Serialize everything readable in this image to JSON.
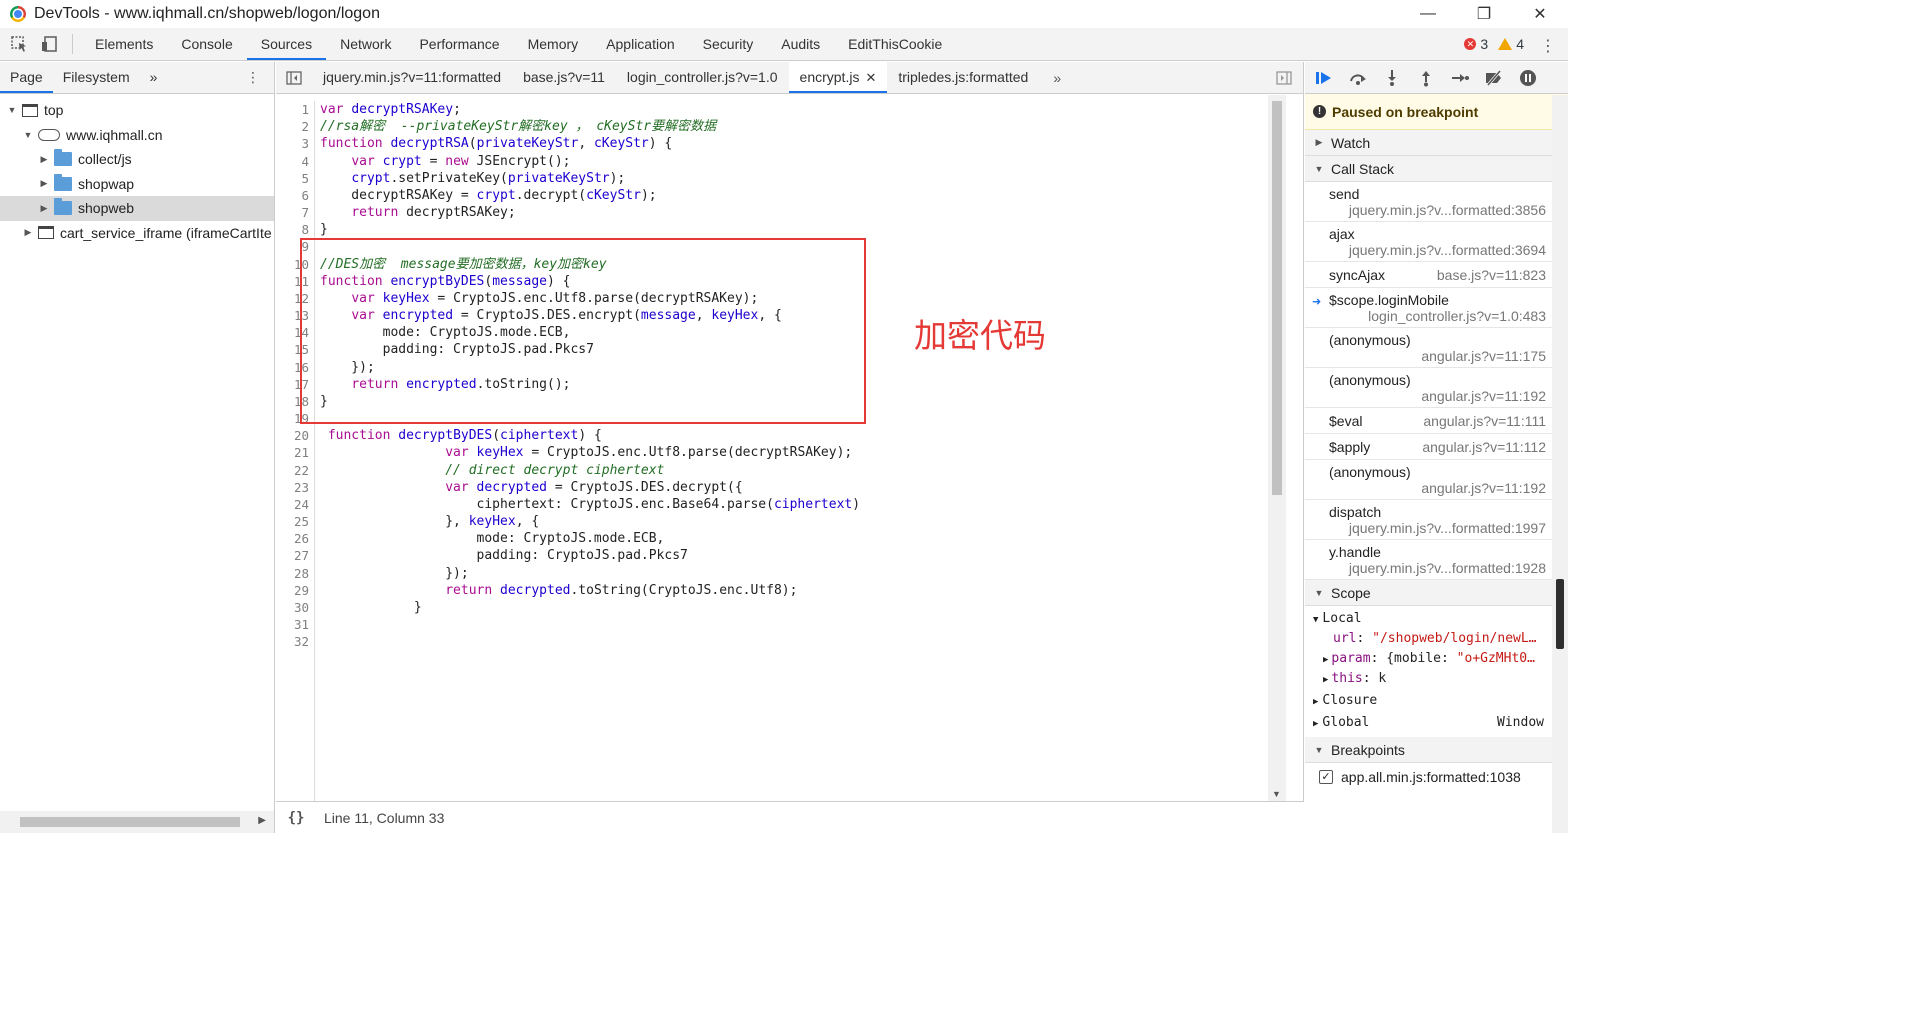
{
  "window": {
    "title": "DevTools - www.iqhmall.cn/shopweb/logon/logon",
    "minimize": "—",
    "restore": "❐",
    "close": "✕"
  },
  "toolbar": {
    "tabs": [
      "Elements",
      "Console",
      "Sources",
      "Network",
      "Performance",
      "Memory",
      "Application",
      "Security",
      "Audits",
      "EditThisCookie"
    ],
    "active_tab": "Sources",
    "error_count": "3",
    "warning_count": "4"
  },
  "navigator": {
    "tabs": [
      "Page",
      "Filesystem"
    ],
    "more": "»",
    "tree": [
      {
        "label": "top",
        "indent": 0,
        "icon": "frame",
        "expanded": true
      },
      {
        "label": "www.iqhmall.cn",
        "indent": 1,
        "icon": "cloud",
        "expanded": true
      },
      {
        "label": "collect/js",
        "indent": 2,
        "icon": "folder",
        "expanded": false
      },
      {
        "label": "shopwap",
        "indent": 2,
        "icon": "folder",
        "expanded": false
      },
      {
        "label": "shopweb",
        "indent": 2,
        "icon": "folder",
        "expanded": false,
        "selected": true
      },
      {
        "label": "cart_service_iframe (iframeCartIte",
        "indent": 1,
        "icon": "frame",
        "expanded": false
      }
    ]
  },
  "editor": {
    "tabs": [
      "jquery.min.js?v=11:formatted",
      "base.js?v=11",
      "login_controller.js?v=1.0",
      "encrypt.js",
      "tripledes.js:formatted"
    ],
    "active_tab": "encrypt.js",
    "status": "Line 11, Column 33",
    "annotation": "加密代码",
    "lines": [
      [
        [
          "kw",
          "var"
        ],
        [
          "pl",
          " "
        ],
        [
          "v",
          "decryptRSAKey"
        ],
        [
          "pl",
          ";"
        ]
      ],
      [
        [
          "cm",
          "//rsa解密  --privateKeyStr解密key ， cKeyStr要解密数据"
        ]
      ],
      [
        [
          "kw",
          "function"
        ],
        [
          "pl",
          " "
        ],
        [
          "fn",
          "decryptRSA"
        ],
        [
          "pl",
          "("
        ],
        [
          "v",
          "privateKeyStr"
        ],
        [
          "pl",
          ", "
        ],
        [
          "v",
          "cKeyStr"
        ],
        [
          "pl",
          ") {"
        ]
      ],
      [
        [
          "pl",
          "    "
        ],
        [
          "kw",
          "var"
        ],
        [
          "pl",
          " "
        ],
        [
          "v",
          "crypt"
        ],
        [
          "pl",
          " = "
        ],
        [
          "kw",
          "new"
        ],
        [
          "pl",
          " JSEncrypt();"
        ]
      ],
      [
        [
          "pl",
          "    "
        ],
        [
          "v",
          "crypt"
        ],
        [
          "pl",
          ".setPrivateKey("
        ],
        [
          "v",
          "privateKeyStr"
        ],
        [
          "pl",
          ");"
        ]
      ],
      [
        [
          "pl",
          "    decryptRSAKey = "
        ],
        [
          "v",
          "crypt"
        ],
        [
          "pl",
          ".decrypt("
        ],
        [
          "v",
          "cKeyStr"
        ],
        [
          "pl",
          ");"
        ]
      ],
      [
        [
          "pl",
          "    "
        ],
        [
          "kw",
          "return"
        ],
        [
          "pl",
          " decryptRSAKey;"
        ]
      ],
      [
        [
          "pl",
          "}"
        ]
      ],
      [
        [
          "pl",
          ""
        ]
      ],
      [
        [
          "cm",
          "//DES加密  message要加密数据，key加密key"
        ]
      ],
      [
        [
          "kw",
          "function"
        ],
        [
          "pl",
          " "
        ],
        [
          "fn",
          "encryptByDES"
        ],
        [
          "pl",
          "("
        ],
        [
          "v",
          "message"
        ],
        [
          "pl",
          ") {"
        ]
      ],
      [
        [
          "pl",
          "    "
        ],
        [
          "kw",
          "var"
        ],
        [
          "pl",
          " "
        ],
        [
          "v",
          "keyHex"
        ],
        [
          "pl",
          " = CryptoJS.enc.Utf8.parse(decryptRSAKey);"
        ]
      ],
      [
        [
          "pl",
          "    "
        ],
        [
          "kw",
          "var"
        ],
        [
          "pl",
          " "
        ],
        [
          "v",
          "encrypted"
        ],
        [
          "pl",
          " = CryptoJS.DES.encrypt("
        ],
        [
          "v",
          "message"
        ],
        [
          "pl",
          ", "
        ],
        [
          "v",
          "keyHex"
        ],
        [
          "pl",
          ", {"
        ]
      ],
      [
        [
          "pl",
          "        mode: CryptoJS.mode.ECB,"
        ]
      ],
      [
        [
          "pl",
          "        padding: CryptoJS.pad.Pkcs7"
        ]
      ],
      [
        [
          "pl",
          "    });"
        ]
      ],
      [
        [
          "pl",
          "    "
        ],
        [
          "kw",
          "return"
        ],
        [
          "pl",
          " "
        ],
        [
          "v",
          "encrypted"
        ],
        [
          "pl",
          ".toString();"
        ]
      ],
      [
        [
          "pl",
          "}"
        ]
      ],
      [
        [
          "pl",
          ""
        ]
      ],
      [
        [
          "pl",
          " "
        ],
        [
          "kw",
          "function"
        ],
        [
          "pl",
          " "
        ],
        [
          "fn",
          "decryptByDES"
        ],
        [
          "pl",
          "("
        ],
        [
          "v",
          "ciphertext"
        ],
        [
          "pl",
          ") {"
        ]
      ],
      [
        [
          "pl",
          "                "
        ],
        [
          "kw",
          "var"
        ],
        [
          "pl",
          " "
        ],
        [
          "v",
          "keyHex"
        ],
        [
          "pl",
          " = CryptoJS.enc.Utf8.parse(decryptRSAKey);"
        ]
      ],
      [
        [
          "pl",
          "                "
        ],
        [
          "cm",
          "// direct decrypt ciphertext"
        ]
      ],
      [
        [
          "pl",
          "                "
        ],
        [
          "kw",
          "var"
        ],
        [
          "pl",
          " "
        ],
        [
          "v",
          "decrypted"
        ],
        [
          "pl",
          " = CryptoJS.DES.decrypt({"
        ]
      ],
      [
        [
          "pl",
          "                    ciphertext: CryptoJS.enc.Base64.parse("
        ],
        [
          "v",
          "ciphertext"
        ],
        [
          "pl",
          ")"
        ]
      ],
      [
        [
          "pl",
          "                }, "
        ],
        [
          "v",
          "keyHex"
        ],
        [
          "pl",
          ", {"
        ]
      ],
      [
        [
          "pl",
          "                    mode: CryptoJS.mode.ECB,"
        ]
      ],
      [
        [
          "pl",
          "                    padding: CryptoJS.pad.Pkcs7"
        ]
      ],
      [
        [
          "pl",
          "                });"
        ]
      ],
      [
        [
          "pl",
          "                "
        ],
        [
          "kw",
          "return"
        ],
        [
          "pl",
          " "
        ],
        [
          "v",
          "decrypted"
        ],
        [
          "pl",
          ".toString(CryptoJS.enc.Utf8);"
        ]
      ],
      [
        [
          "pl",
          "            }"
        ]
      ],
      [
        [
          "pl",
          ""
        ]
      ],
      [
        [
          "pl",
          ""
        ]
      ]
    ]
  },
  "debugger": {
    "paused_text": "Paused on breakpoint",
    "watch_label": "Watch",
    "callstack_label": "Call Stack",
    "callstack": [
      {
        "name": "send",
        "loc": "jquery.min.js?v...formatted:3856",
        "inline": false,
        "current": false
      },
      {
        "name": "ajax",
        "loc": "jquery.min.js?v...formatted:3694",
        "inline": false,
        "current": false
      },
      {
        "name": "syncAjax",
        "loc": "base.js?v=11:823",
        "inline": true,
        "current": false
      },
      {
        "name": "$scope.loginMobile",
        "loc": "login_controller.js?v=1.0:483",
        "inline": false,
        "current": true
      },
      {
        "name": "(anonymous)",
        "loc": "angular.js?v=11:175",
        "inline": false,
        "current": false
      },
      {
        "name": "(anonymous)",
        "loc": "angular.js?v=11:192",
        "inline": false,
        "current": false
      },
      {
        "name": "$eval",
        "loc": "angular.js?v=11:111",
        "inline": true,
        "current": false
      },
      {
        "name": "$apply",
        "loc": "angular.js?v=11:112",
        "inline": true,
        "current": false
      },
      {
        "name": "(anonymous)",
        "loc": "angular.js?v=11:192",
        "inline": false,
        "current": false
      },
      {
        "name": "dispatch",
        "loc": "jquery.min.js?v...formatted:1997",
        "inline": false,
        "current": false
      },
      {
        "name": "y.handle",
        "loc": "jquery.min.js?v...formatted:1928",
        "inline": false,
        "current": false
      }
    ],
    "scope_label": "Scope",
    "scope": {
      "local_label": "Local",
      "url_key": "url",
      "url_val": "\"/shopweb/login/newL…",
      "param_key": "param",
      "param_val_prefix": "{mobile: ",
      "param_val_str": "\"o+GzMHt0…",
      "this_key": "this",
      "this_val": "k",
      "closure_label": "Closure",
      "global_label": "Global",
      "global_val": "Window"
    },
    "breakpoints_label": "Breakpoints",
    "breakpoint": "app.all.min.js:formatted:1038"
  }
}
